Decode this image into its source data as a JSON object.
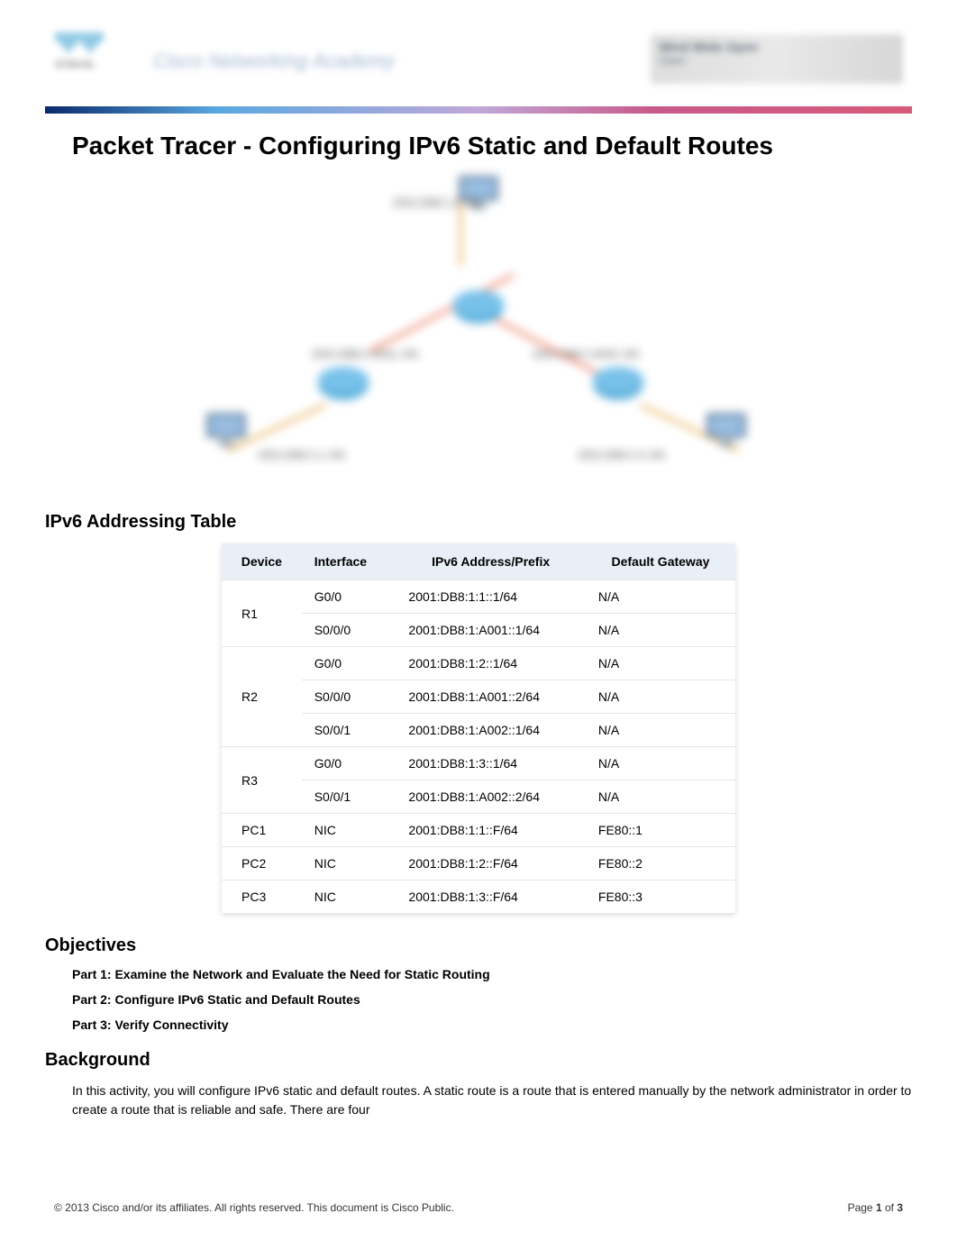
{
  "header": {
    "brand": "cisco.",
    "academy": "Cisco Networking Academy",
    "right_line1": "Mind Wide Open",
    "right_line2": "Open"
  },
  "title": "Packet Tracer - Configuring IPv6 Static and Default Routes",
  "topology": {
    "top_label": "2001:DB8:1:2::/64",
    "left_link": "2001:DB8:1:A001::/64",
    "right_link": "2001:DB8:1:A002::/64",
    "bottom_left": "2001:DB8:1:1::/64",
    "bottom_right": "2001:DB8:1:3::/64"
  },
  "addressing_heading": "IPv6 Addressing Table",
  "table_headers": {
    "device": "Device",
    "interface": "Interface",
    "address": "IPv6 Address/Prefix",
    "gateway": "Default Gateway"
  },
  "rows": [
    {
      "device": "R1",
      "iface": "G0/0",
      "addr": "2001:DB8:1:1::1/64",
      "gw": "N/A"
    },
    {
      "device": "",
      "iface": "S0/0/0",
      "addr": "2001:DB8:1:A001::1/64",
      "gw": "N/A"
    },
    {
      "device": "R2",
      "iface": "G0/0",
      "addr": "2001:DB8:1:2::1/64",
      "gw": "N/A"
    },
    {
      "device": "",
      "iface": "S0/0/0",
      "addr": "2001:DB8:1:A001::2/64",
      "gw": "N/A"
    },
    {
      "device": "",
      "iface": "S0/0/1",
      "addr": "2001:DB8:1:A002::1/64",
      "gw": "N/A"
    },
    {
      "device": "R3",
      "iface": "G0/0",
      "addr": "2001:DB8:1:3::1/64",
      "gw": "N/A"
    },
    {
      "device": "",
      "iface": "S0/0/1",
      "addr": "2001:DB8:1:A002::2/64",
      "gw": "N/A"
    },
    {
      "device": "PC1",
      "iface": "NIC",
      "addr": "2001:DB8:1:1::F/64",
      "gw": "FE80::1"
    },
    {
      "device": "PC2",
      "iface": "NIC",
      "addr": "2001:DB8:1:2::F/64",
      "gw": "FE80::2"
    },
    {
      "device": "PC3",
      "iface": "NIC",
      "addr": "2001:DB8:1:3::F/64",
      "gw": "FE80::3"
    }
  ],
  "objectives_heading": "Objectives",
  "objectives": [
    "Part 1: Examine the Network and Evaluate the Need for Static Routing",
    "Part 2: Configure IPv6 Static and Default Routes",
    "Part 3: Verify Connectivity"
  ],
  "background_heading": "Background",
  "background_text": "In this activity, you will configure IPv6 static and default routes. A static route is a route that is entered manually by the network administrator in order to create a route that is reliable and safe. There are four",
  "footer": {
    "copyright": "© 2013 Cisco and/or its affiliates. All rights reserved. This document is Cisco Public.",
    "page_prefix": "Page ",
    "page_current": "1",
    "page_of": " of ",
    "page_total": "3"
  }
}
